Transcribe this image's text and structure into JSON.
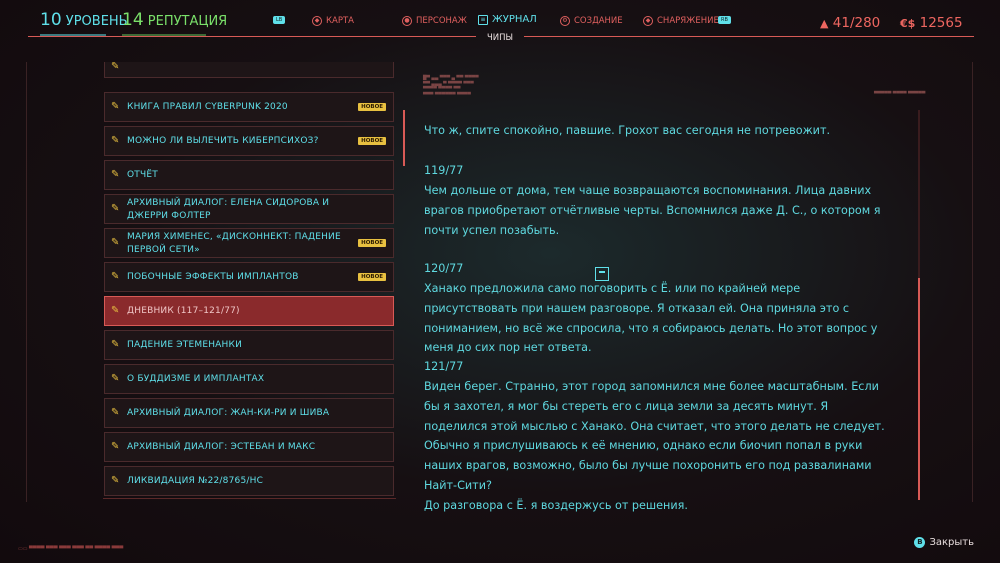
{
  "header": {
    "level_num": "10",
    "level_label": "УРОВЕНЬ",
    "rep_num": "14",
    "rep_label": "РЕПУТАЦИЯ",
    "nav": [
      {
        "label": "КАРТА",
        "icon": "map-icon"
      },
      {
        "label": "ПЕРСОНАЖ",
        "icon": "character-icon"
      },
      {
        "label": "ЖУРНАЛ",
        "icon": "journal-icon",
        "active": true
      },
      {
        "label": "СОЗДАНИЕ",
        "icon": "crafting-icon"
      },
      {
        "label": "СНАРЯЖЕНИЕ",
        "icon": "inventory-icon"
      }
    ],
    "left_key": "LB",
    "right_key": "RB",
    "subtab": "ЧИПЫ",
    "carry": "41/280",
    "money": "12565",
    "money_symbol": "€$"
  },
  "list": {
    "items": [
      {
        "label": "КНИГА ПРАВИЛ CYBERPUNK 2020",
        "badge": "НОВОЕ"
      },
      {
        "label": "МОЖНО ЛИ ВЫЛЕЧИТЬ КИБЕРПСИХОЗ?",
        "badge": "НОВОЕ"
      },
      {
        "label": "ОТЧЁТ",
        "badge": ""
      },
      {
        "label": "АРХИВНЫЙ ДИАЛОГ: ЕЛЕНА СИДОРОВА И ДЖЕРРИ ФОЛТЕР",
        "badge": ""
      },
      {
        "label": "МАРИЯ ХИМЕНЕС, «ДИСКОННЕКТ: ПАДЕНИЕ ПЕРВОЙ СЕТИ»",
        "badge": "НОВОЕ"
      },
      {
        "label": "ПОБОЧНЫЕ ЭФФЕКТЫ ИМПЛАНТОВ",
        "badge": "НОВОЕ"
      },
      {
        "label": "ДНЕВНИК (117–121/77)",
        "badge": "",
        "selected": true
      },
      {
        "label": "ПАДЕНИЕ ЭТЕМЕНАНКИ",
        "badge": ""
      },
      {
        "label": "О БУДДИЗМЕ И ИМПЛАНТАХ",
        "badge": ""
      },
      {
        "label": "АРХИВНЫЙ ДИАЛОГ: ЖАН-КИ-РИ И ШИВА",
        "badge": ""
      },
      {
        "label": "АРХИВНЫЙ ДИАЛОГ: ЭСТЕБАН И МАКС",
        "badge": ""
      },
      {
        "label": "ЛИКВИДАЦИЯ №22/8765/НС",
        "badge": ""
      }
    ]
  },
  "content": {
    "intro": "Что ж, спите спокойно, павшие. Грохот вас сегодня не потревожит.",
    "entries": [
      {
        "num": "119/77",
        "text": "Чем дольше от дома, тем чаще возвращаются воспоминания. Лица давних врагов приобретают отчётливые черты. Вспомнился даже Д. С., о котором я почти успел позабыть."
      },
      {
        "num": "120/77",
        "text": "Ханако предложила само поговорить с Ё. или по крайней мере присутствовать при нашем разговоре. Я отказал ей. Она приняла это с пониманием, но всё же спросила, что я собираюсь делать. Но этот вопрос у меня до сих пор нет ответа."
      },
      {
        "num": "121/77",
        "text": "Виден берег. Странно, этот город запомнился мне более масштабным. Если бы я захотел, я мог бы стереть его с лица земли за десять минут. Я поделился этой мыслью с Ханако. Она считает, что этого делать не следует. Обычно я прислушиваюсь к её мнению, однако если биочип попал в руки наших врагов, возможно, было бы лучше похоронить его под развалинами Найт-Сити?\nДо разговора с Ё. я воздержусь от решения."
      }
    ]
  },
  "footer": {
    "close_key": "B",
    "close_label": "Закрыть"
  },
  "colors": {
    "accent_cyan": "#5fe0ea",
    "accent_red": "#d85a56",
    "badge_yellow": "#e8c040",
    "selected_bg": "#8a2a2c"
  }
}
